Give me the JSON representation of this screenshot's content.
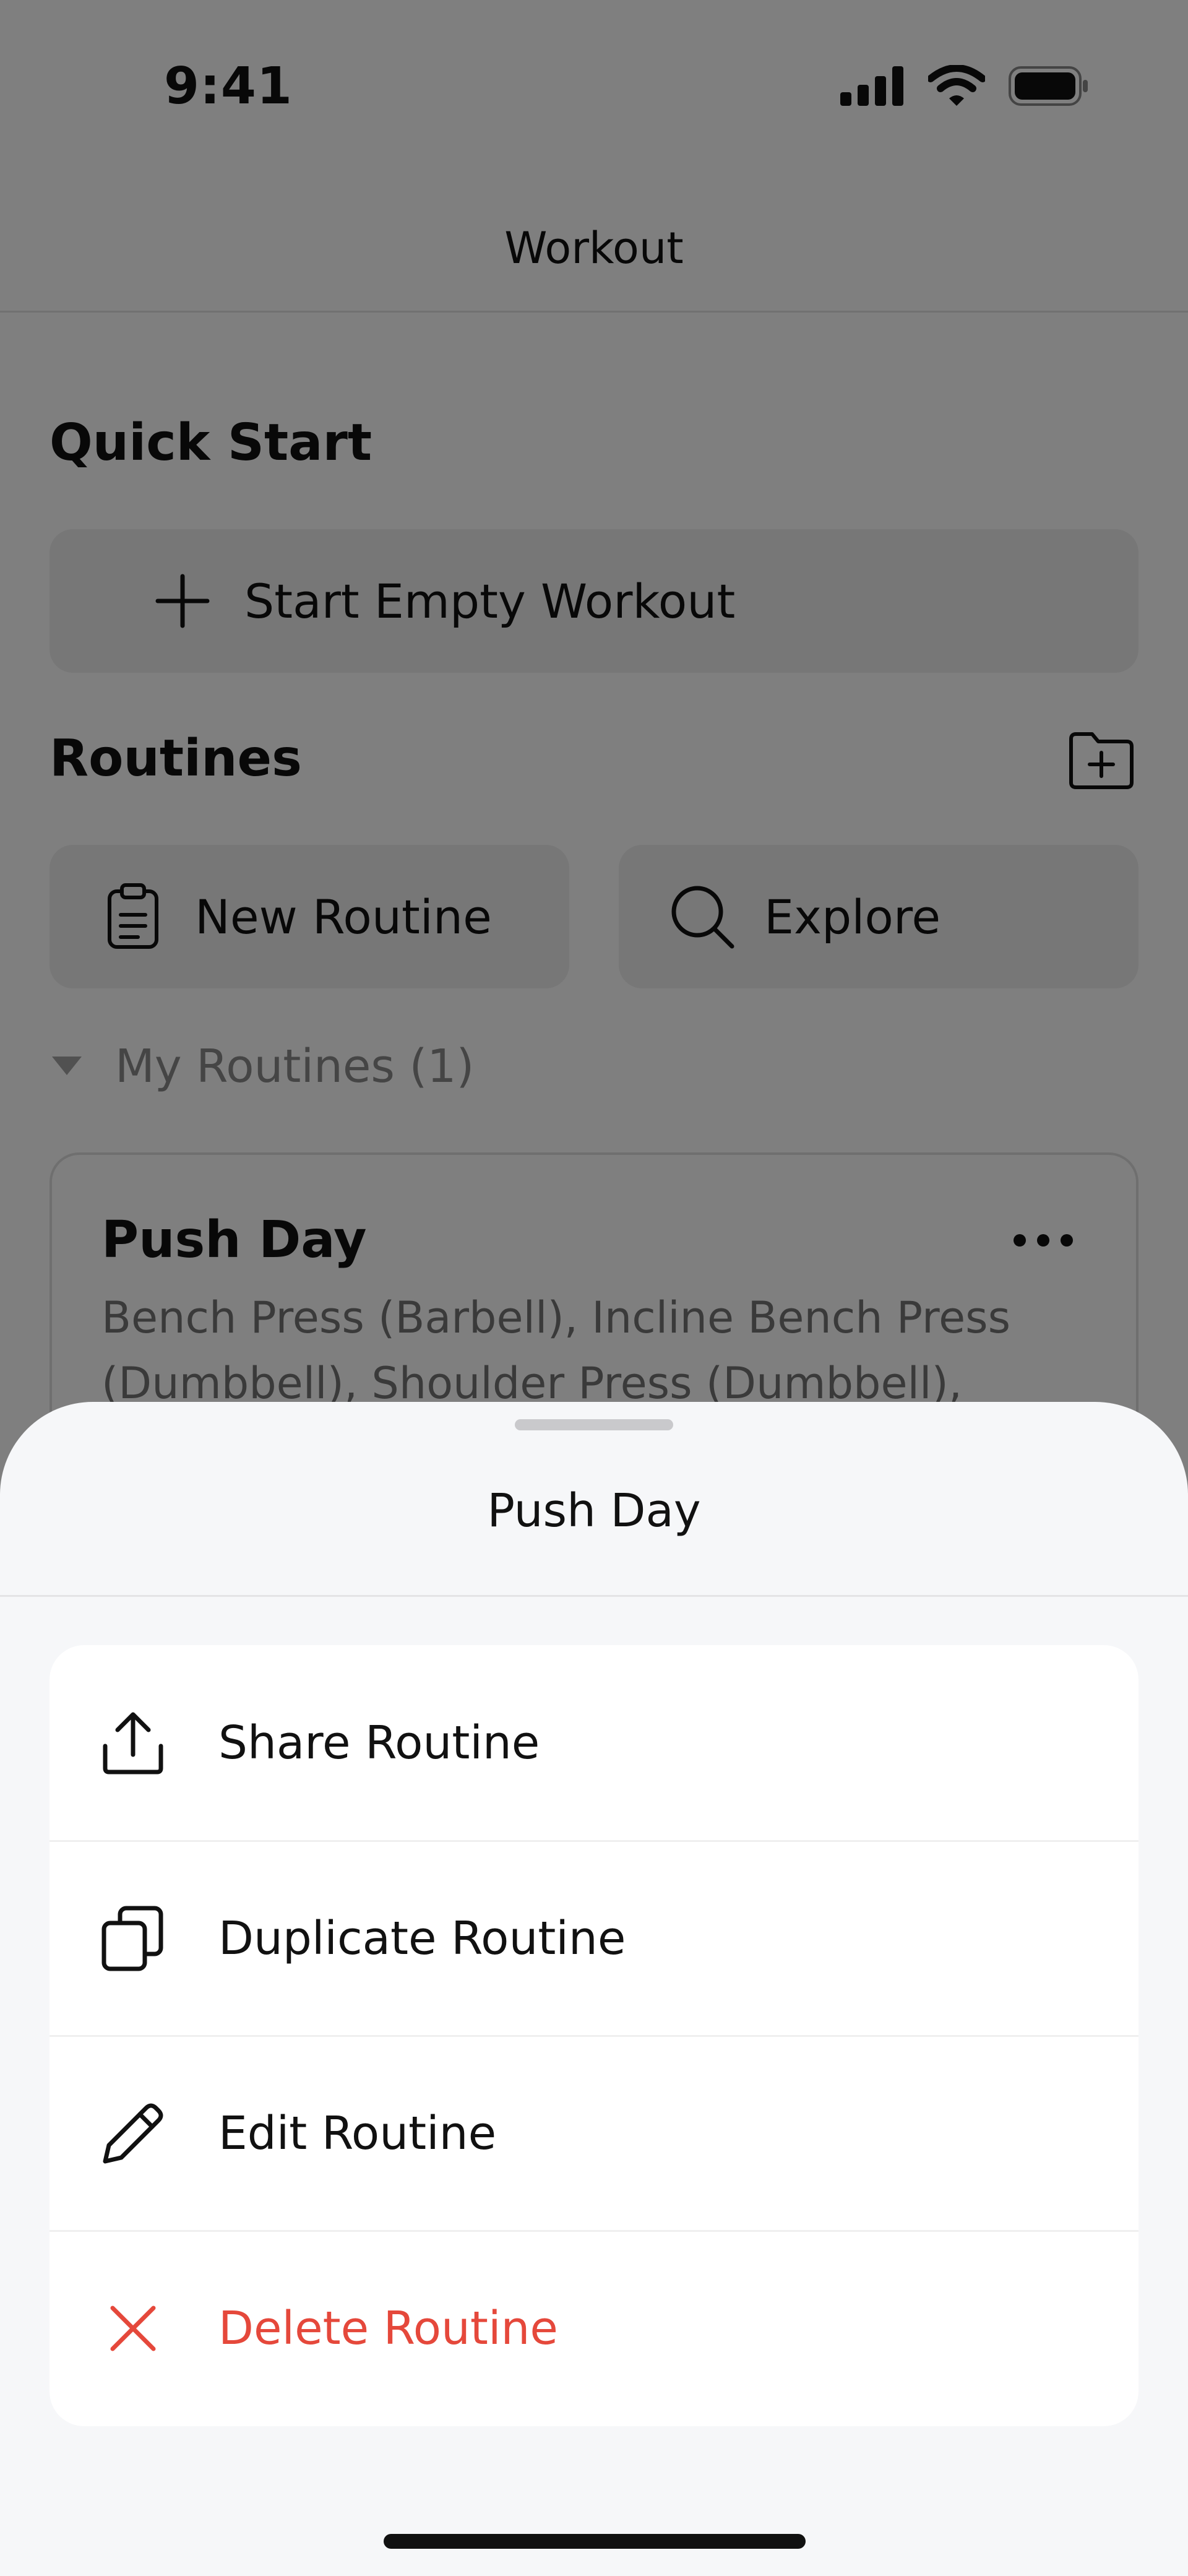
{
  "status_bar": {
    "time": "9:41"
  },
  "nav": {
    "title": "Workout"
  },
  "quick_start": {
    "title": "Quick Start",
    "start_empty_label": "Start Empty Workout"
  },
  "routines": {
    "title": "Routines",
    "new_routine_label": "New Routine",
    "explore_label": "Explore",
    "my_routines_label": "My Routines (1)",
    "cards": [
      {
        "title": "Push Day",
        "description": "Bench Press (Barbell), Incline Bench Press (Dumbbell), Shoulder Press (Dumbbell), Late..."
      }
    ]
  },
  "sheet": {
    "title": "Push Day",
    "actions": [
      {
        "label": "Share Routine",
        "icon": "share-icon"
      },
      {
        "label": "Duplicate Routine",
        "icon": "duplicate-icon"
      },
      {
        "label": "Edit Routine",
        "icon": "pencil-icon"
      },
      {
        "label": "Delete Routine",
        "icon": "close-icon",
        "color": "#e5483b"
      }
    ]
  },
  "colors": {
    "danger": "#e5483b",
    "overlay": "rgba(0,0,0,0.5)",
    "sheet_background": "#f6f7f9",
    "button_background": "#eeeeef"
  }
}
